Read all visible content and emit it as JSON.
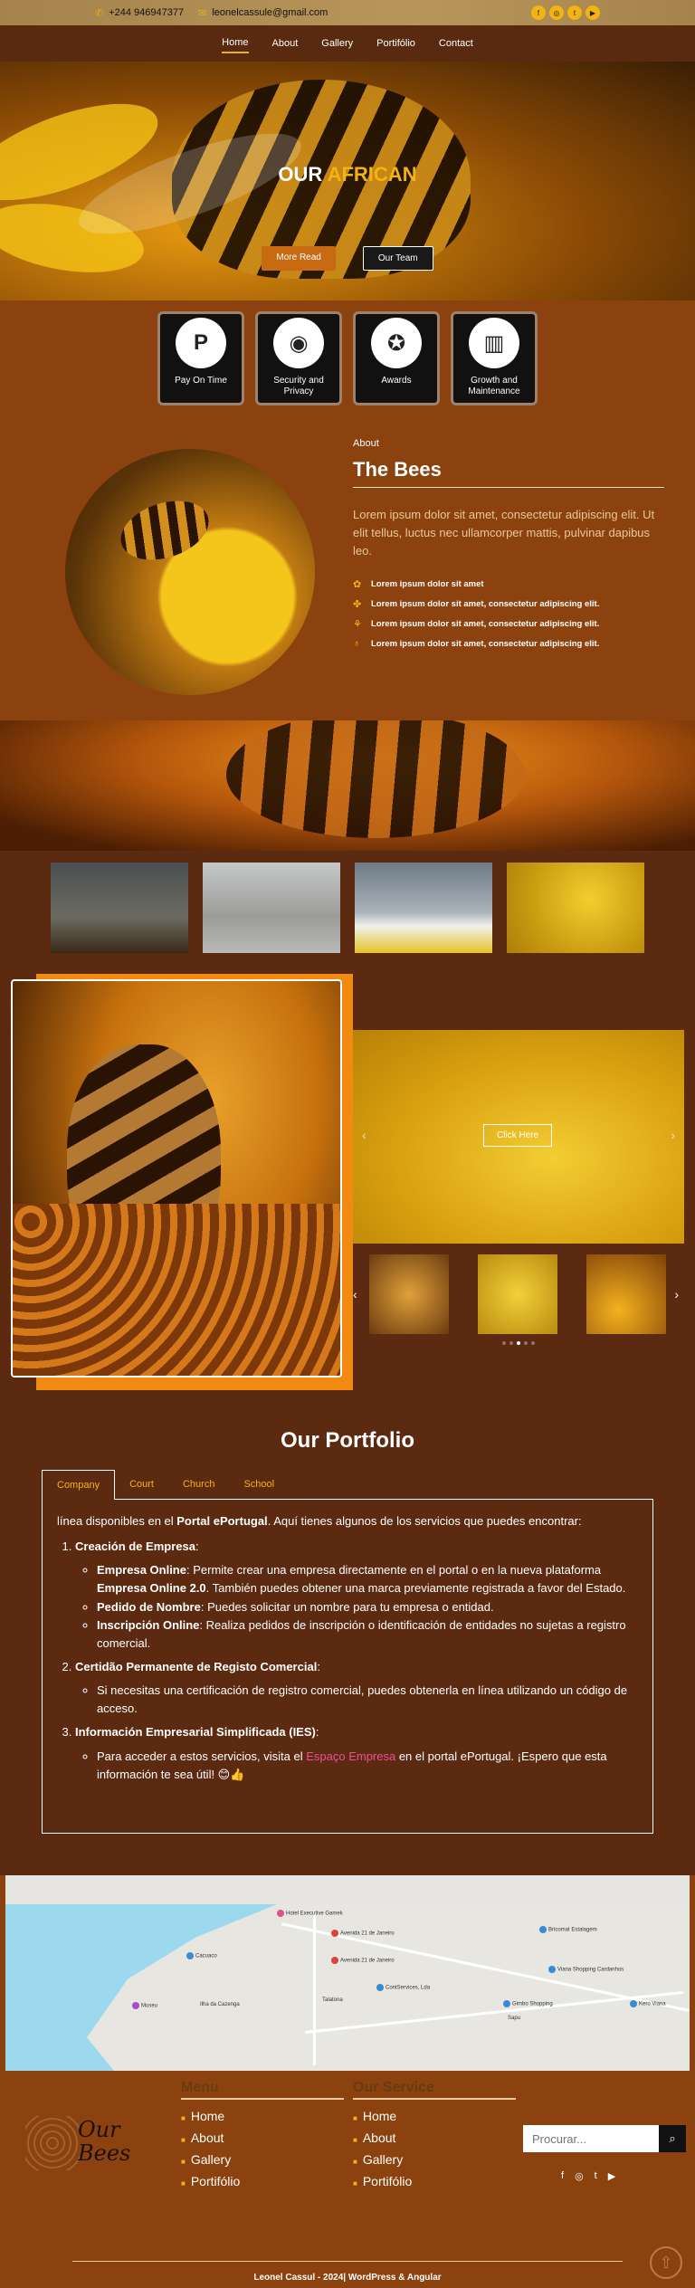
{
  "topbar": {
    "phone": "+244 946947377",
    "email": "leonelcassule@gmail.com",
    "social": [
      "facebook-icon",
      "instagram-icon",
      "twitter-icon",
      "youtube-icon"
    ]
  },
  "nav": {
    "items": [
      "Home",
      "About",
      "Gallery",
      "Portifólio",
      "Contact"
    ]
  },
  "hero": {
    "title_a": "OUR ",
    "title_b": "AFRICAN",
    "btn_more": "More Read",
    "btn_team": "Our Team"
  },
  "features": [
    {
      "icon": "paypal-icon",
      "glyph": "P",
      "label": "Pay On Time"
    },
    {
      "icon": "eye-icon",
      "glyph": "◉",
      "label": "Security and Privacy"
    },
    {
      "icon": "award-icon",
      "glyph": "✪",
      "label": "Awards"
    },
    {
      "icon": "chart-icon",
      "glyph": "▥",
      "label": "Growth and Maintenance"
    }
  ],
  "about": {
    "kicker": "About",
    "title": "The Bees",
    "text": "Lorem ipsum dolor sit amet, consectetur adipiscing elit. Ut elit tellus, luctus nec ullamcorper mattis, pulvinar dapibus leo.",
    "items": [
      "Lorem ipsum dolor sit amet",
      "Lorem ipsum dolor sit amet, consectetur adipiscing elit.",
      "Lorem ipsum dolor sit amet, consectetur adipiscing elit.",
      "Lorem ipsum dolor sit amet, consectetur adipiscing elit."
    ]
  },
  "slider": {
    "cta": "Click Here"
  },
  "portfolio": {
    "title": "Our Portfolio",
    "tabs": [
      "Company",
      "Court",
      "Church",
      "School"
    ],
    "intro_a": "línea disponibles en el ",
    "intro_b": "Portal ePortugal",
    "intro_c": ". Aquí tienes algunos de los servicios que puedes encontrar:",
    "s1_title": "Creación de Empresa",
    "s1_a_b": "Empresa Online",
    "s1_a_t": ": Permite crear una empresa directamente en el portal o en la nueva plataforma ",
    "s1_a_b2": "Empresa Online 2.0",
    "s1_a_t2": ". También puedes obtener una marca previamente registrada a favor del Estado.",
    "s1_b_b": "Pedido de Nombre",
    "s1_b_t": ": Puedes solicitar un nombre para tu empresa o entidad.",
    "s1_c_b": "Inscripción Online",
    "s1_c_t": ": Realiza pedidos de inscripción o identificación de entidades no sujetas a registro comercial.",
    "s2_title": "Certidão Permanente de Registo Comercial",
    "s2_a": "Si necesitas una certificación de registro comercial, puedes obtenerla en línea utilizando un código de acceso.",
    "s3_title": "Información Empresarial Simplificada (IES)",
    "s3_a1": "Para acceder a estos servicios, visita el ",
    "s3_link": "Espaço Empresa",
    "s3_a2": " en el portal ePortugal. ¡Espero que esta información te sea útil! 😊👍"
  },
  "map": {
    "labels": [
      "Hotel Executive Gamek",
      "Avenida 21 de Janeiro",
      "Avenida 21 de Janeiro",
      "Bricomat Estalagem",
      "Viana Shopping Cardanhos",
      "Gimbo Shopping",
      "Kero Viana",
      "ContServices, Lda",
      "Talatona",
      "Museu",
      "Ilha da Cazenga",
      "Sapu",
      "Cacuaco"
    ]
  },
  "footer": {
    "logo_line1": "Our",
    "logo_line2": "Bees",
    "menu_title": "Menu",
    "menu": [
      "Home",
      "About",
      "Gallery",
      "Portifólio"
    ],
    "service_title": "Our Service",
    "service": [
      "Home",
      "About",
      "Gallery",
      "Portifólio"
    ],
    "search_placeholder": "Procurar...",
    "copyright": "Leonel Cassul - 2024| WordPress & Angular"
  }
}
